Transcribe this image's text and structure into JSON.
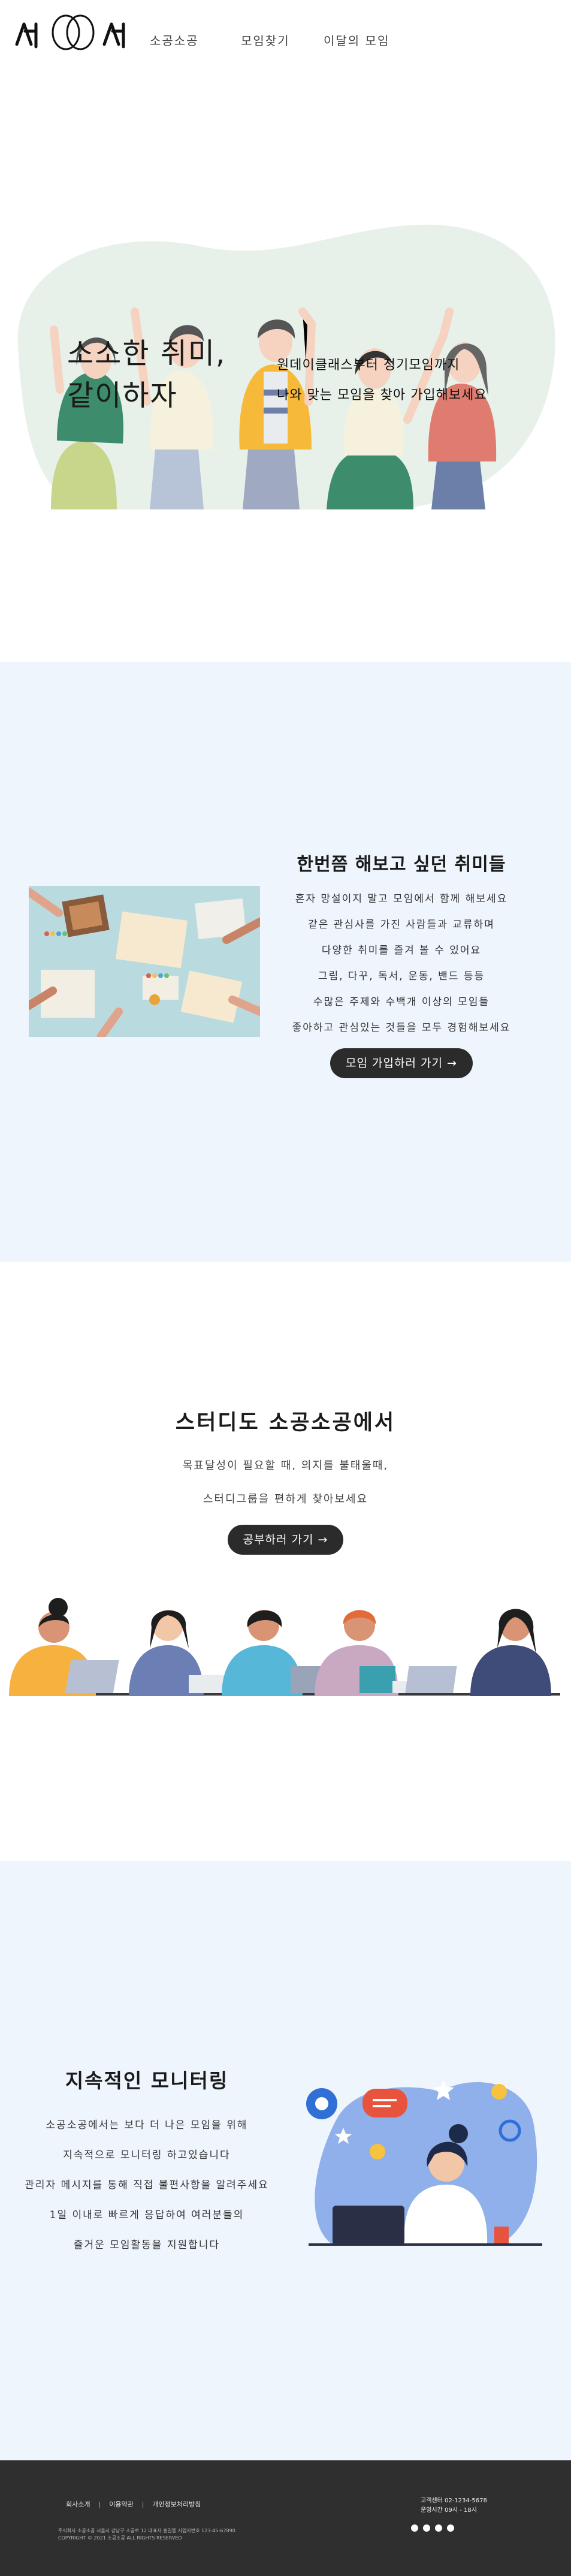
{
  "header": {
    "logo_text": "소공소공",
    "nav": [
      "소공소공",
      "모임찾기",
      "이달의 모임"
    ]
  },
  "hero": {
    "title_line1": "소소한 취미,",
    "title_line2": "같이하자",
    "sub_line1": "원데이클래스부터 정기모임까지",
    "sub_line2": "나와 맞는 모임을 찾아 가입해보세요"
  },
  "hobby": {
    "title": "한번쯤 해보고 싶던 취미들",
    "lines": [
      "혼자 망설이지 말고 모임에서 함께 해보세요",
      "같은 관심사를 가진 사람들과 교류하며",
      "다양한 취미를 즐겨 볼 수 있어요",
      "그림, 다꾸, 독서, 운동, 밴드 등등",
      "수많은 주제와 수백개 이상의 모임들",
      "좋아하고 관심있는 것들을 모두 경험해보세요"
    ],
    "button": "모임 가입하러 가기 →"
  },
  "study": {
    "title": "스터디도 소공소공에서",
    "lines": [
      "목표달성이 필요할 때, 의지를 불태울때,",
      "스터디그룹을 편하게 찾아보세요"
    ],
    "button": "공부하러 가기 →"
  },
  "monitoring": {
    "title": "지속적인 모니터링",
    "lines": [
      "소공소공에서는 보다 더 나은 모임을 위해",
      "지속적으로 모니터링 하고있습니다",
      "관리자 메시지를 통해 직접 불편사항을 알려주세요",
      "1일 이내로 빠르게 응답하여 여러분들의",
      "즐거운 모임활동을 지원합니다"
    ]
  },
  "footer": {
    "links": [
      "회사소개",
      "이용약관",
      "개인정보처리방침"
    ],
    "info_line1": "주식회사 소공소공 서울시 강남구 소공로 12 대표자 홍길동 사업자번호 123-45-67890",
    "info_line2": "COPYRIGHT © 2021 소공소공 ALL RIGHTS RESERVED",
    "contact_line1": "고객센터 02-1234-5678",
    "contact_line2": "운영시간 09시 - 18시",
    "social": [
      "facebook-icon",
      "instagram-icon",
      "twitter-icon",
      "youtube-icon"
    ]
  },
  "colors": {
    "section_bg": "#eef5fd",
    "button_bg": "#2b2b2b",
    "footer_bg": "#2f2f2f"
  }
}
